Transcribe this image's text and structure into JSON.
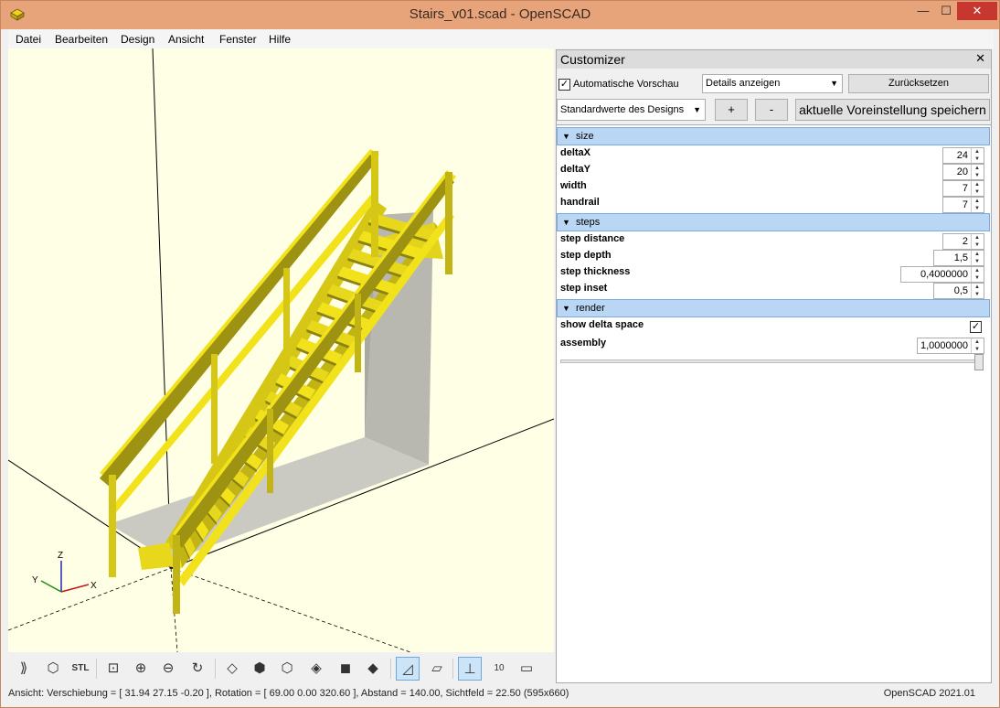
{
  "window": {
    "title": "Stairs_v01.scad - OpenSCAD",
    "min_glyph": "—",
    "max_glyph": "☐",
    "close_glyph": "✕"
  },
  "menu": [
    "Datei",
    "Bearbeiten",
    "Design",
    "Ansicht",
    "Fenster",
    "Hilfe"
  ],
  "viewport": {
    "axis_labels": {
      "x": "X",
      "y": "Y",
      "z": "Z"
    },
    "colors": {
      "background": "#ffffe5",
      "stair": "#f2e21c",
      "stair_dark": "#c2b414",
      "stair_shadow": "#8c8210",
      "ghost": "#c8c8c0"
    }
  },
  "toolbar": {
    "icons": [
      "preview-render-icon",
      "render-icon",
      "export-stl-icon",
      "zoom-all-icon",
      "zoom-in-icon",
      "zoom-out-icon",
      "reset-view-icon",
      "view-right-icon",
      "view-top-icon",
      "view-bottom-icon",
      "view-left-icon",
      "view-front-icon",
      "view-back-icon",
      "perspective-icon",
      "orthogonal-icon",
      "show-axes-icon",
      "show-scale-icon",
      "show-edges-icon"
    ],
    "stl_label": "STL",
    "scale_label": "10"
  },
  "status": {
    "left": "Ansicht: Verschiebung = [ 31.94 27.15 -0.20 ], Rotation = [ 69.00 0.00 320.60 ], Abstand = 140.00, Sichtfeld = 22.50 (595x660)",
    "right": "OpenSCAD 2021.01"
  },
  "customizer": {
    "title": "Customizer",
    "close_glyph": "✕",
    "auto_preview_label": "Automatische Vorschau",
    "auto_preview_checked": true,
    "details_value": "Details anzeigen",
    "reset_label": "Zurücksetzen",
    "preset_value": "Standardwerte des Designs",
    "plus_label": "+",
    "minus_label": "-",
    "save_preset_label": "aktuelle Voreinstellung speichern",
    "groups": [
      {
        "name": "size",
        "params": [
          {
            "label": "deltaX",
            "value": "24"
          },
          {
            "label": "deltaY",
            "value": "20"
          },
          {
            "label": "width",
            "value": "7"
          },
          {
            "label": "handrail",
            "value": "7"
          }
        ]
      },
      {
        "name": "steps",
        "params": [
          {
            "label": "step distance",
            "value": "2"
          },
          {
            "label": "step depth",
            "value": "1,5"
          },
          {
            "label": "step thickness",
            "value": "0,4000000"
          },
          {
            "label": "step inset",
            "value": "0,5"
          }
        ]
      },
      {
        "name": "render",
        "params": [
          {
            "label": "show delta space",
            "checked": true
          },
          {
            "label": "assembly",
            "value": "1,0000000",
            "slider_fraction": 1.0
          }
        ]
      }
    ]
  }
}
